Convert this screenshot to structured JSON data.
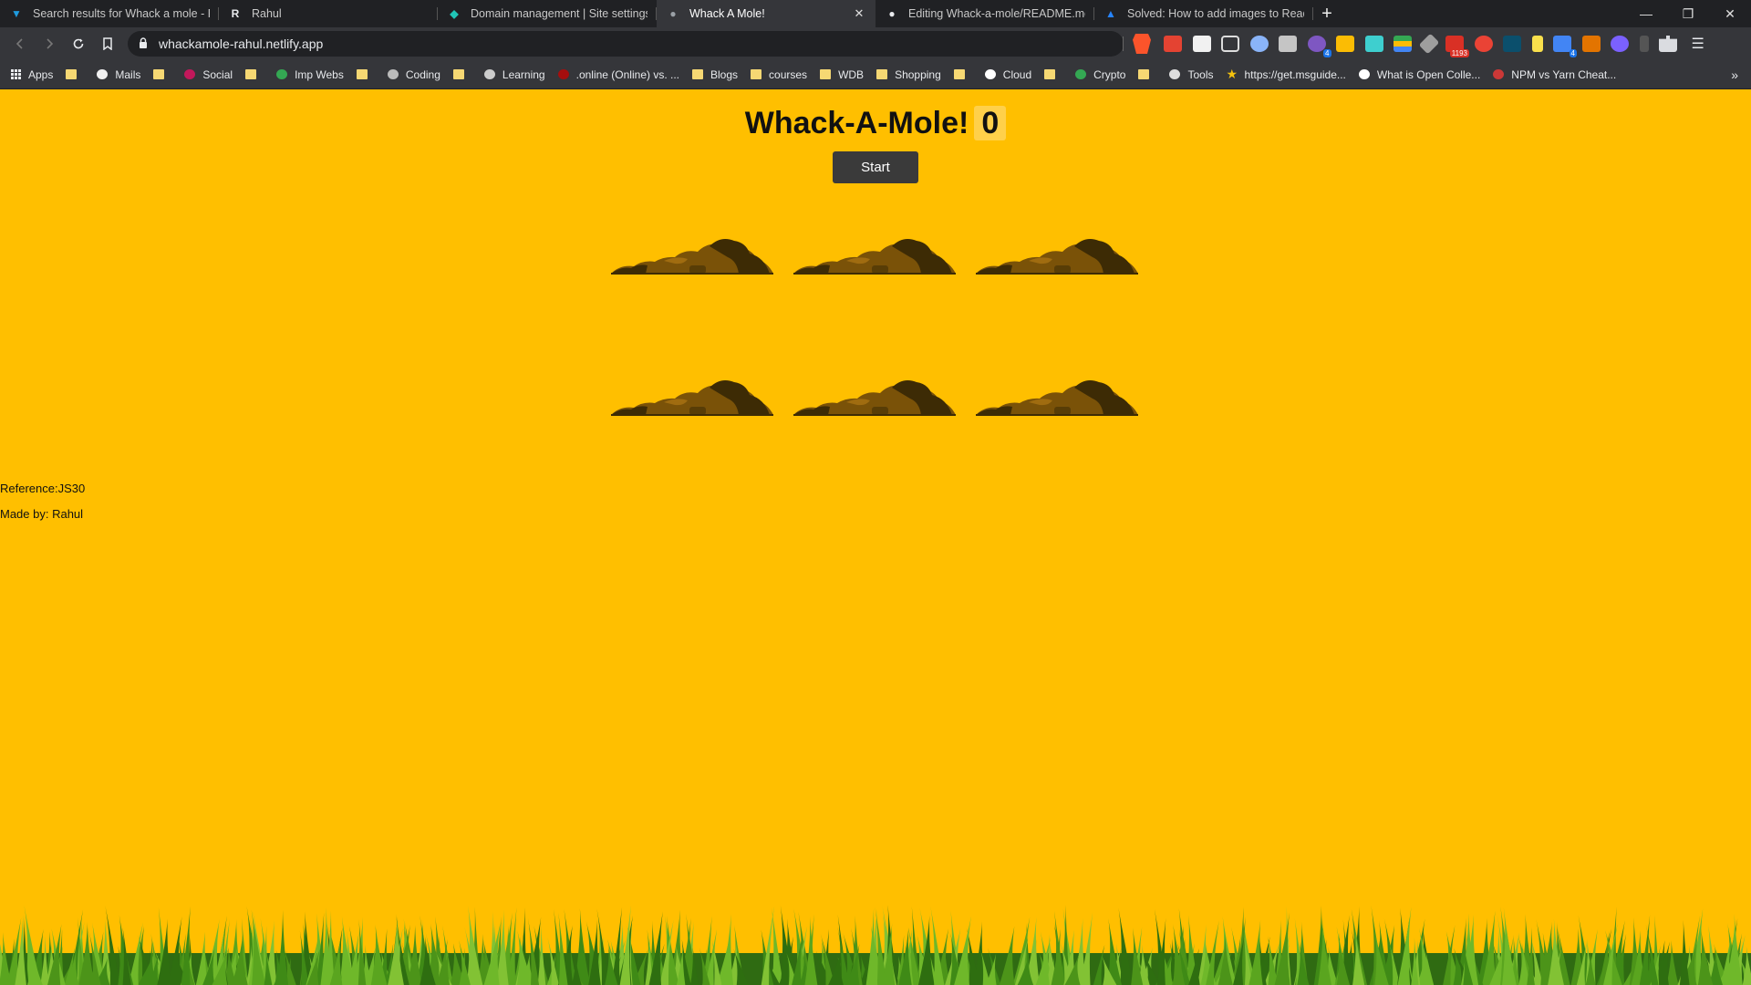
{
  "browser": {
    "tabs": [
      {
        "title": "Search results for Whack a mole - Flat",
        "favicon": "vuetify-icon",
        "color": "#1f9bde"
      },
      {
        "title": "Rahul",
        "favicon": "r-logo-icon",
        "color": "#e8eaed"
      },
      {
        "title": "Domain management | Site settings",
        "favicon": "netlify-icon",
        "color": "#20c6b7"
      },
      {
        "title": "Whack A Mole!",
        "favicon": "globe-icon",
        "color": "#9aa0a6",
        "active": true
      },
      {
        "title": "Editing Whack-a-mole/README.md at",
        "favicon": "github-icon",
        "color": "#e8eaed"
      },
      {
        "title": "Solved: How to add images to Readm",
        "favicon": "atlassian-icon",
        "color": "#2684ff"
      }
    ],
    "new_tab": "+",
    "url": "whackamole-rahul.netlify.app",
    "extension_badges": {
      "mail": "1193",
      "notes": "4",
      "other": "4"
    },
    "bookmarks": [
      {
        "label": "Apps",
        "icon": "apps-grid-icon"
      },
      {
        "label": "",
        "icon": "folder-icon"
      },
      {
        "label": "Mails",
        "icon": "mail-icon"
      },
      {
        "label": "",
        "icon": "folder-icon"
      },
      {
        "label": "Social",
        "icon": "social-icon"
      },
      {
        "label": "",
        "icon": "folder-icon"
      },
      {
        "label": "Imp Webs",
        "icon": "globe-icon"
      },
      {
        "label": "",
        "icon": "folder-icon"
      },
      {
        "label": "Coding",
        "icon": "code-icon"
      },
      {
        "label": "",
        "icon": "folder-icon"
      },
      {
        "label": "Learning",
        "icon": "book-icon"
      },
      {
        "label": ".online (Online) vs. ...",
        "icon": "site-icon"
      },
      {
        "label": "Blogs",
        "icon": "folder-icon"
      },
      {
        "label": "courses",
        "icon": "folder-icon"
      },
      {
        "label": "WDB",
        "icon": "folder-icon"
      },
      {
        "label": "Shopping",
        "icon": "folder-icon"
      },
      {
        "label": "",
        "icon": "folder-icon"
      },
      {
        "label": "Cloud",
        "icon": "cloud-icon"
      },
      {
        "label": "",
        "icon": "folder-icon"
      },
      {
        "label": "Crypto",
        "icon": "crypto-icon"
      },
      {
        "label": "",
        "icon": "folder-icon"
      },
      {
        "label": "Tools",
        "icon": "tools-icon"
      },
      {
        "label": "https://get.msguide...",
        "icon": "star-icon"
      },
      {
        "label": "What is Open Colle...",
        "icon": "l-logo-icon"
      },
      {
        "label": "NPM vs Yarn Cheat...",
        "icon": "npm-icon"
      }
    ],
    "more": "»"
  },
  "game": {
    "title": "Whack-A-Mole!",
    "score": "0",
    "start_label": "Start",
    "holes": 6,
    "colors": {
      "background": "#ffbf00",
      "dirt_dark": "#3d2b05",
      "dirt_mid": "#7a5208",
      "dirt_light": "#a06c10",
      "button": "#3a3a3a"
    }
  },
  "footer": {
    "reference": "Reference:JS30",
    "made_by": "Made by: Rahul"
  }
}
